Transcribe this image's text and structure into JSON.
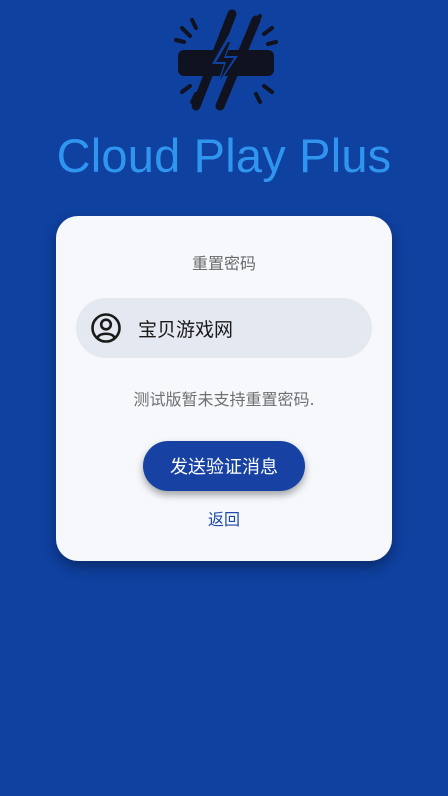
{
  "app": {
    "title": "Cloud Play Plus"
  },
  "card": {
    "heading": "重置密码",
    "username_value": "宝贝游戏网",
    "notice": "测试版暂未支持重置密码.",
    "send_button_label": "发送验证消息",
    "back_link_label": "返回"
  },
  "icons": {
    "logo": "lightning-plug-logo",
    "user": "account-circle-icon"
  },
  "colors": {
    "background": "#0f41a1",
    "title": "#2f95ee",
    "card": "#f6f8fc",
    "field": "#e4e8f1",
    "button": "#1742a3"
  }
}
